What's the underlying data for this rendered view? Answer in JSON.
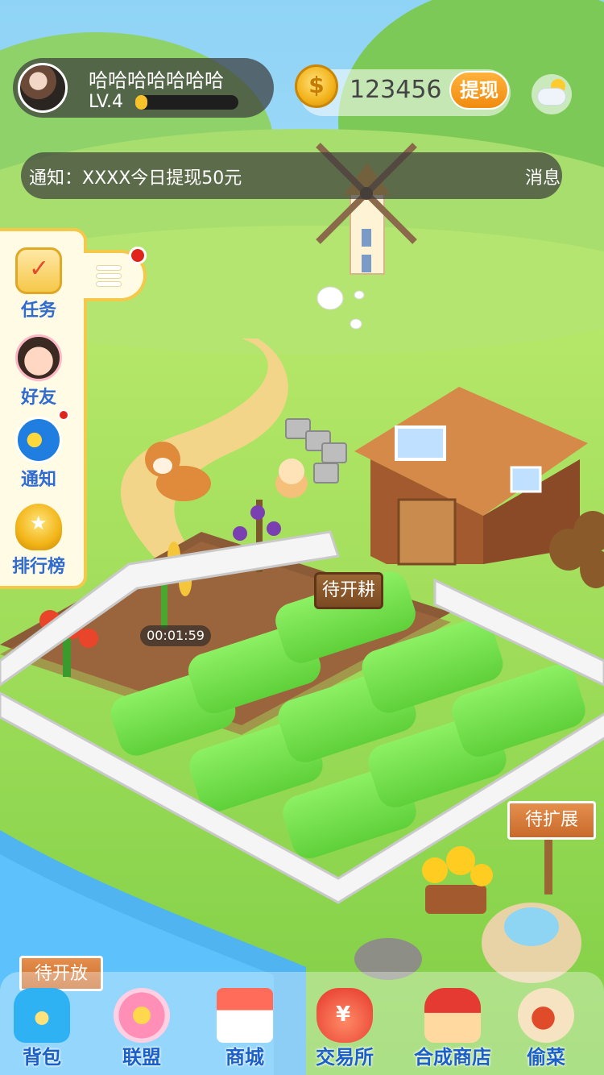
{
  "profile": {
    "name": "哈哈哈哈哈哈哈",
    "level": "LV.4",
    "xp_progress": 0.12
  },
  "wallet": {
    "coin_symbol": "$",
    "coins": "123456",
    "withdraw_label": "提现"
  },
  "notice": {
    "text": "通知：XXXX今日提现50元",
    "message_label": "消息"
  },
  "side_menu": [
    {
      "label": "任务",
      "icon": "task-list-icon"
    },
    {
      "label": "好友",
      "icon": "friend-icon"
    },
    {
      "label": "通知",
      "icon": "megaphone-icon"
    },
    {
      "label": "排行榜",
      "icon": "trophy-icon"
    }
  ],
  "farm": {
    "timer": "00:01:59",
    "plow_sign": "待开耕",
    "expand_sign": "待扩展",
    "open_sign": "待开放"
  },
  "bottom_nav": [
    {
      "label": "背包",
      "icon": "backpack-icon"
    },
    {
      "label": "联盟",
      "icon": "alliance-badge-icon"
    },
    {
      "label": "商城",
      "icon": "shop-icon"
    },
    {
      "label": "交易所",
      "icon": "money-bag-icon"
    },
    {
      "label": "合成商店",
      "icon": "house-icon"
    },
    {
      "label": "偷菜",
      "icon": "steal-hand-icon"
    }
  ],
  "colors": {
    "accent": "#f08b0e",
    "nav_text": "#1b5fc8",
    "side_text": "#2f6bd1",
    "grass": "#7ed957"
  }
}
